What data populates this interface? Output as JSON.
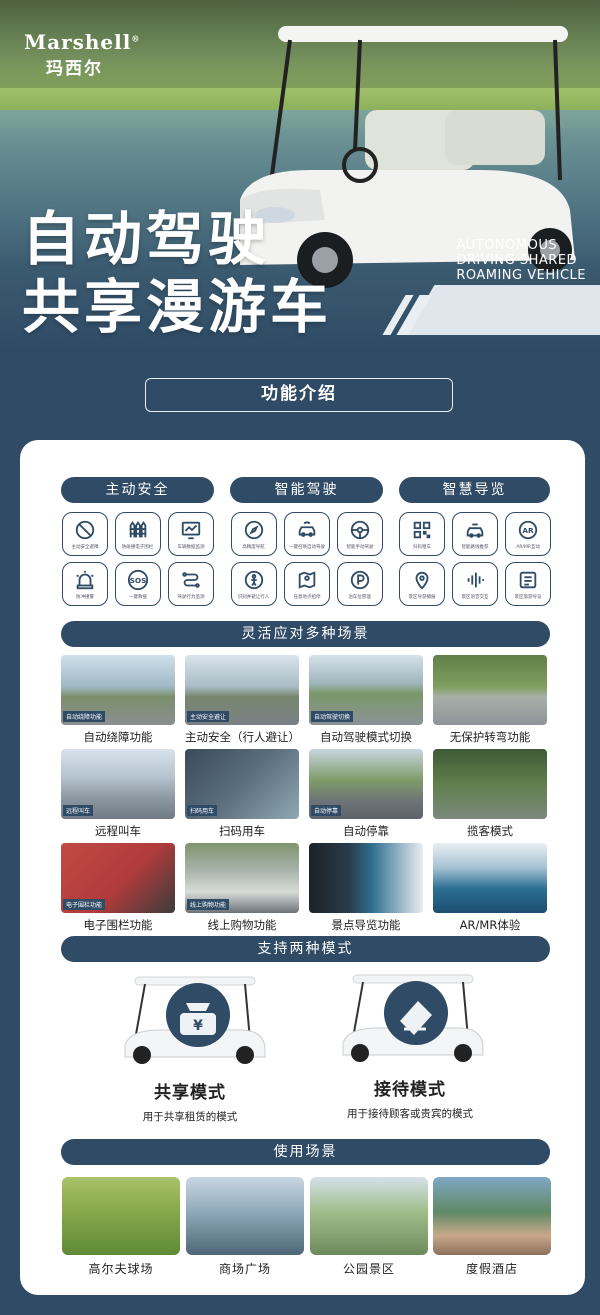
{
  "brand": {
    "name_en": "Marshell",
    "registered": "®",
    "name_cn": "玛西尔"
  },
  "hero": {
    "title_line1": "自动驾驶",
    "title_line2": "共享漫游车",
    "subtitle_line1": "AUTONOMOUS",
    "subtitle_line2": "DRIVING SHARED",
    "subtitle_line3": "ROAMING VEHICLE"
  },
  "features": {
    "title": "功能介绍",
    "categories": [
      {
        "label": "主动安全",
        "items": [
          "主动安全避障",
          "防碰撞电子围栏",
          "车辆数据监测",
          "防冲撞警",
          "一键救援",
          "驾驶行为监测"
        ],
        "icons": [
          "no-entry-icon",
          "fence-icon",
          "monitor-chart-icon",
          "alarm-icon",
          "sos-icon",
          "route-icon"
        ]
      },
      {
        "label": "智能驾驶",
        "items": [
          "高精度导航",
          "一键召唤自动驾驶",
          "智能手动驾驶",
          "识别并避让行人",
          "任意地点招停",
          "泊车位管理"
        ],
        "icons": [
          "compass-icon",
          "car-summon-icon",
          "steering-wheel-icon",
          "pedestrian-icon",
          "map-pin-icon",
          "parking-icon"
        ]
      },
      {
        "label": "智慧导览",
        "items": [
          "扫码租车",
          "智能路线推荐",
          "AR/MR互动",
          "景区导游播报",
          "景区语音交互",
          "景区旅游导览"
        ],
        "icons": [
          "qr-code-icon",
          "car-route-icon",
          "ar-icon",
          "location-icon",
          "voice-wave-icon",
          "list-icon"
        ]
      }
    ]
  },
  "scenarios": {
    "title": "灵活应对多种场景",
    "items": [
      {
        "caption": "自动绕障功能",
        "tag": "自动绕障功能"
      },
      {
        "caption": "主动安全（行人避让）",
        "tag": "主动安全避让"
      },
      {
        "caption": "自动驾驶模式切换",
        "tag": "自动驾驶切换"
      },
      {
        "caption": "无保护转弯功能",
        "tag": ""
      },
      {
        "caption": "远程叫车",
        "tag": "远程叫车"
      },
      {
        "caption": "扫码用车",
        "tag": "扫码用车"
      },
      {
        "caption": "自动停靠",
        "tag": "自动停靠"
      },
      {
        "caption": "揽客模式",
        "tag": ""
      },
      {
        "caption": "电子围栏功能",
        "tag": "电子围栏功能"
      },
      {
        "caption": "线上购物功能",
        "tag": "线上购物功能"
      },
      {
        "caption": "景点导览功能",
        "tag": ""
      },
      {
        "caption": "AR/MR体验",
        "tag": ""
      }
    ]
  },
  "modes": {
    "title": "支持两种模式",
    "items": [
      {
        "name": "共享模式",
        "desc": "用于共享租赁的模式",
        "icon": "money-bag-icon"
      },
      {
        "name": "接待模式",
        "desc": "用于接待顾客或贵宾的模式",
        "icon": "reception-icon"
      }
    ]
  },
  "usage": {
    "title": "使用场景",
    "items": [
      {
        "caption": "高尔夫球场"
      },
      {
        "caption": "商场广场"
      },
      {
        "caption": "公园景区"
      },
      {
        "caption": "度假酒店"
      }
    ]
  },
  "colors": {
    "primary": "#2f4b66",
    "card": "#ffffff",
    "hero_stripe": "#e9eef3"
  }
}
